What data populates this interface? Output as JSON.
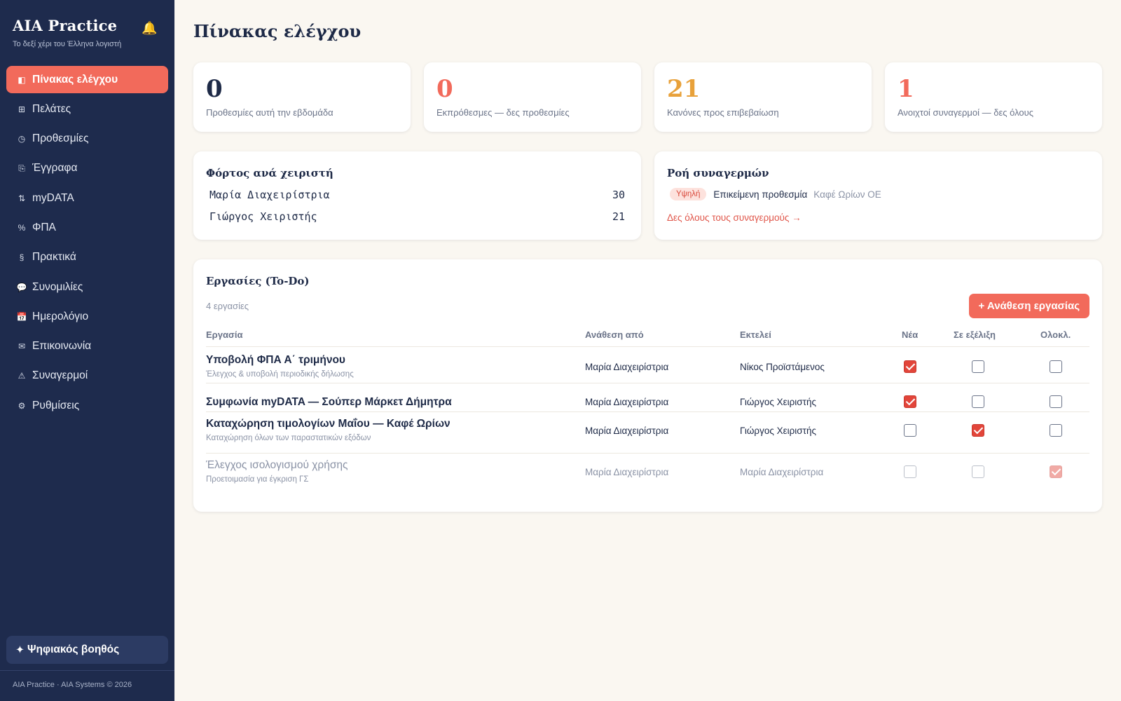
{
  "sidebar": {
    "brand_title": "AIA Practice",
    "brand_subtitle": "Το δεξί χέρι του Έλληνα λογιστή",
    "items": [
      {
        "icon": "◧",
        "label": "Πίνακας ελέγχου",
        "active": true
      },
      {
        "icon": "⊞",
        "label": "Πελάτες"
      },
      {
        "icon": "◷",
        "label": "Προθεσμίες"
      },
      {
        "icon": "⎘",
        "label": "Έγγραφα"
      },
      {
        "icon": "⇅",
        "label": "myDATA"
      },
      {
        "icon": "%",
        "label": "ΦΠΑ"
      },
      {
        "icon": "§",
        "label": "Πρακτικά"
      },
      {
        "icon": "💬",
        "label": "Συνομιλίες"
      },
      {
        "icon": "📅",
        "label": "Ημερολόγιο"
      },
      {
        "icon": "✉",
        "label": "Επικοινωνία"
      },
      {
        "icon": "⚠",
        "label": "Συναγερμοί"
      },
      {
        "icon": "⚙",
        "label": "Ρυθμίσεις"
      }
    ],
    "assistant_label": "Ψηφιακός βοηθός",
    "footer": "AIA Practice · AIA Systems © 2026"
  },
  "page_title": "Πίνακας ελέγχου",
  "stats": [
    {
      "value": "0",
      "label": "Προθεσμίες αυτή την εβδομάδα",
      "color": "#1e2a47"
    },
    {
      "value": "0",
      "label": "Εκπρόθεσμες — δες προθεσμίες",
      "color": "#f26a5b"
    },
    {
      "value": "21",
      "label": "Κανόνες προς επιβεβαίωση",
      "color": "#e8a13a"
    },
    {
      "value": "1",
      "label": "Ανοιχτοί συναγερμοί — δες όλους",
      "color": "#f26a5b"
    }
  ],
  "workload": {
    "title": "Φόρτος ανά χειριστή",
    "rows": [
      {
        "name": "Μαρία Διαχειρίστρια",
        "count": "30"
      },
      {
        "name": "Γιώργος Χειριστής",
        "count": "21"
      }
    ]
  },
  "alerts": {
    "title": "Ροή συναγερμών",
    "items": [
      {
        "severity": "Υψηλή",
        "text": "Επικείμενη προθεσμία",
        "client": "Καφέ Ωρίων ΟΕ"
      }
    ],
    "link": "Δες όλους τους συναγερμούς →"
  },
  "todo": {
    "title": "Εργασίες (To-Do)",
    "count": "4 εργασίες",
    "assign_button": "+ Ανάθεση εργασίας",
    "columns": {
      "task": "Εργασία",
      "assigned_by": "Ανάθεση από",
      "executor": "Εκτελεί",
      "new": "Νέα",
      "in_progress": "Σε εξέλιξη",
      "done": "Ολοκλ."
    },
    "rows": [
      {
        "title": "Υποβολή ΦΠΑ Α΄ τριμήνου",
        "desc": "Έλεγχος & υποβολή περιοδικής δήλωσης",
        "assigned_by": "Μαρία Διαχειρίστρια",
        "executor": "Νίκος Προϊστάμενος",
        "status": "new"
      },
      {
        "title": "Συμφωνία myDATA — Σούπερ Μάρκετ Δήμητρα",
        "desc": "",
        "assigned_by": "Μαρία Διαχειρίστρια",
        "executor": "Γιώργος Χειριστής",
        "status": "new"
      },
      {
        "title": "Καταχώρηση τιμολογίων Μαΐου — Καφέ Ωρίων",
        "desc": "Καταχώρηση όλων των παραστατικών εξόδων",
        "assigned_by": "Μαρία Διαχειρίστρια",
        "executor": "Γιώργος Χειριστής",
        "status": "in_progress"
      },
      {
        "title": "Έλεγχος ισολογισμού χρήσης",
        "desc": "Προετοιμασία για έγκριση ΓΣ",
        "assigned_by": "Μαρία Διαχειρίστρια",
        "executor": "Μαρία Διαχειρίστρια",
        "status": "done"
      }
    ]
  }
}
